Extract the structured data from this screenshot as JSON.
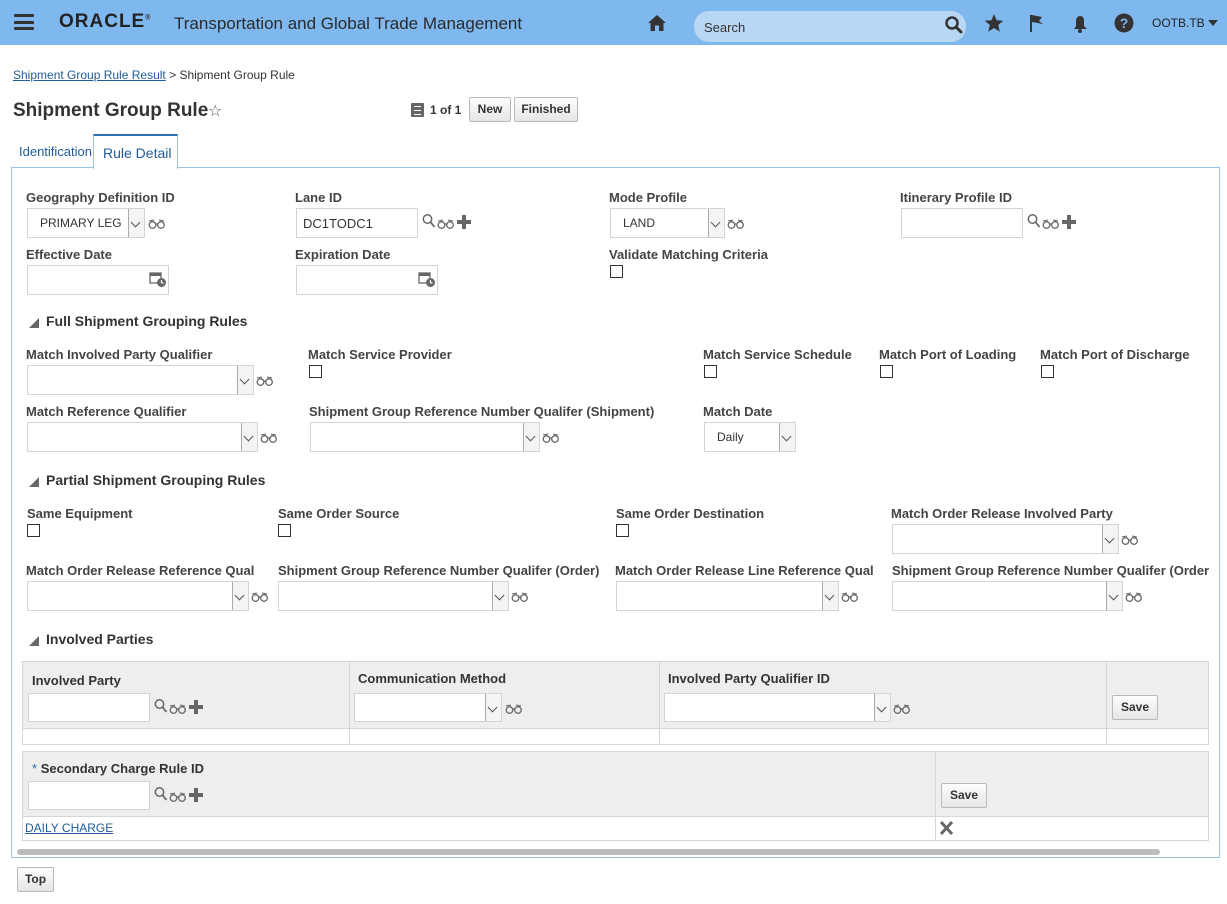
{
  "header": {
    "logo": "ORACLE",
    "app_title": "Transportation and Global Trade Management",
    "search_placeholder": "Search",
    "user": "OOTB.TB"
  },
  "breadcrumb": {
    "parent": "Shipment Group Rule Result",
    "separator": ">",
    "current": "Shipment Group Rule"
  },
  "page": {
    "title": "Shipment Group Rule",
    "pager": "1 of 1",
    "new_label": "New",
    "finished_label": "Finished"
  },
  "tabs": [
    {
      "label": "Identification"
    },
    {
      "label": "Rule Detail"
    }
  ],
  "form": {
    "geo_label": "Geography Definition ID",
    "geo_value": "PRIMARY LEG",
    "lane_label": "Lane ID",
    "lane_value": "DC1TODC1",
    "mode_label": "Mode Profile",
    "mode_value": "LAND",
    "itin_label": "Itinerary Profile ID",
    "eff_label": "Effective Date",
    "exp_label": "Expiration Date",
    "validate_label": "Validate Matching Criteria"
  },
  "full": {
    "title": "Full Shipment Grouping Rules",
    "involved_party_qual": "Match Involved Party Qualifier",
    "service_provider": "Match Service Provider",
    "service_schedule": "Match Service Schedule",
    "port_loading": "Match Port of Loading",
    "port_discharge": "Match Port of Discharge",
    "reference_qual": "Match Reference Qualifier",
    "sg_ref_qual_ship": "Shipment Group Reference Number Qualifer (Shipment)",
    "match_date": "Match Date",
    "match_date_value": "Daily"
  },
  "partial": {
    "title": "Partial Shipment Grouping Rules",
    "same_equipment": "Same Equipment",
    "same_order_source": "Same Order Source",
    "same_order_dest": "Same Order Destination",
    "or_involved_party": "Match Order Release Involved Party",
    "or_ref_qual": "Match Order Release Reference Qual",
    "sg_ref_qual_order": "Shipment Group Reference Number Qualifer (Order)",
    "orl_ref_qual": "Match Order Release Line Reference Qual",
    "sg_ref_qual_order2": "Shipment Group Reference Number Qualifer (Order"
  },
  "involved": {
    "title": "Involved Parties",
    "col_party": "Involved Party",
    "col_comm": "Communication Method",
    "col_qual": "Involved Party Qualifier ID",
    "save": "Save"
  },
  "secondary": {
    "required_mark": "*",
    "col_rule": "Secondary Charge Rule ID",
    "save": "Save",
    "rows": [
      {
        "rule": "DAILY CHARGE"
      }
    ]
  },
  "footer": {
    "top": "Top"
  }
}
